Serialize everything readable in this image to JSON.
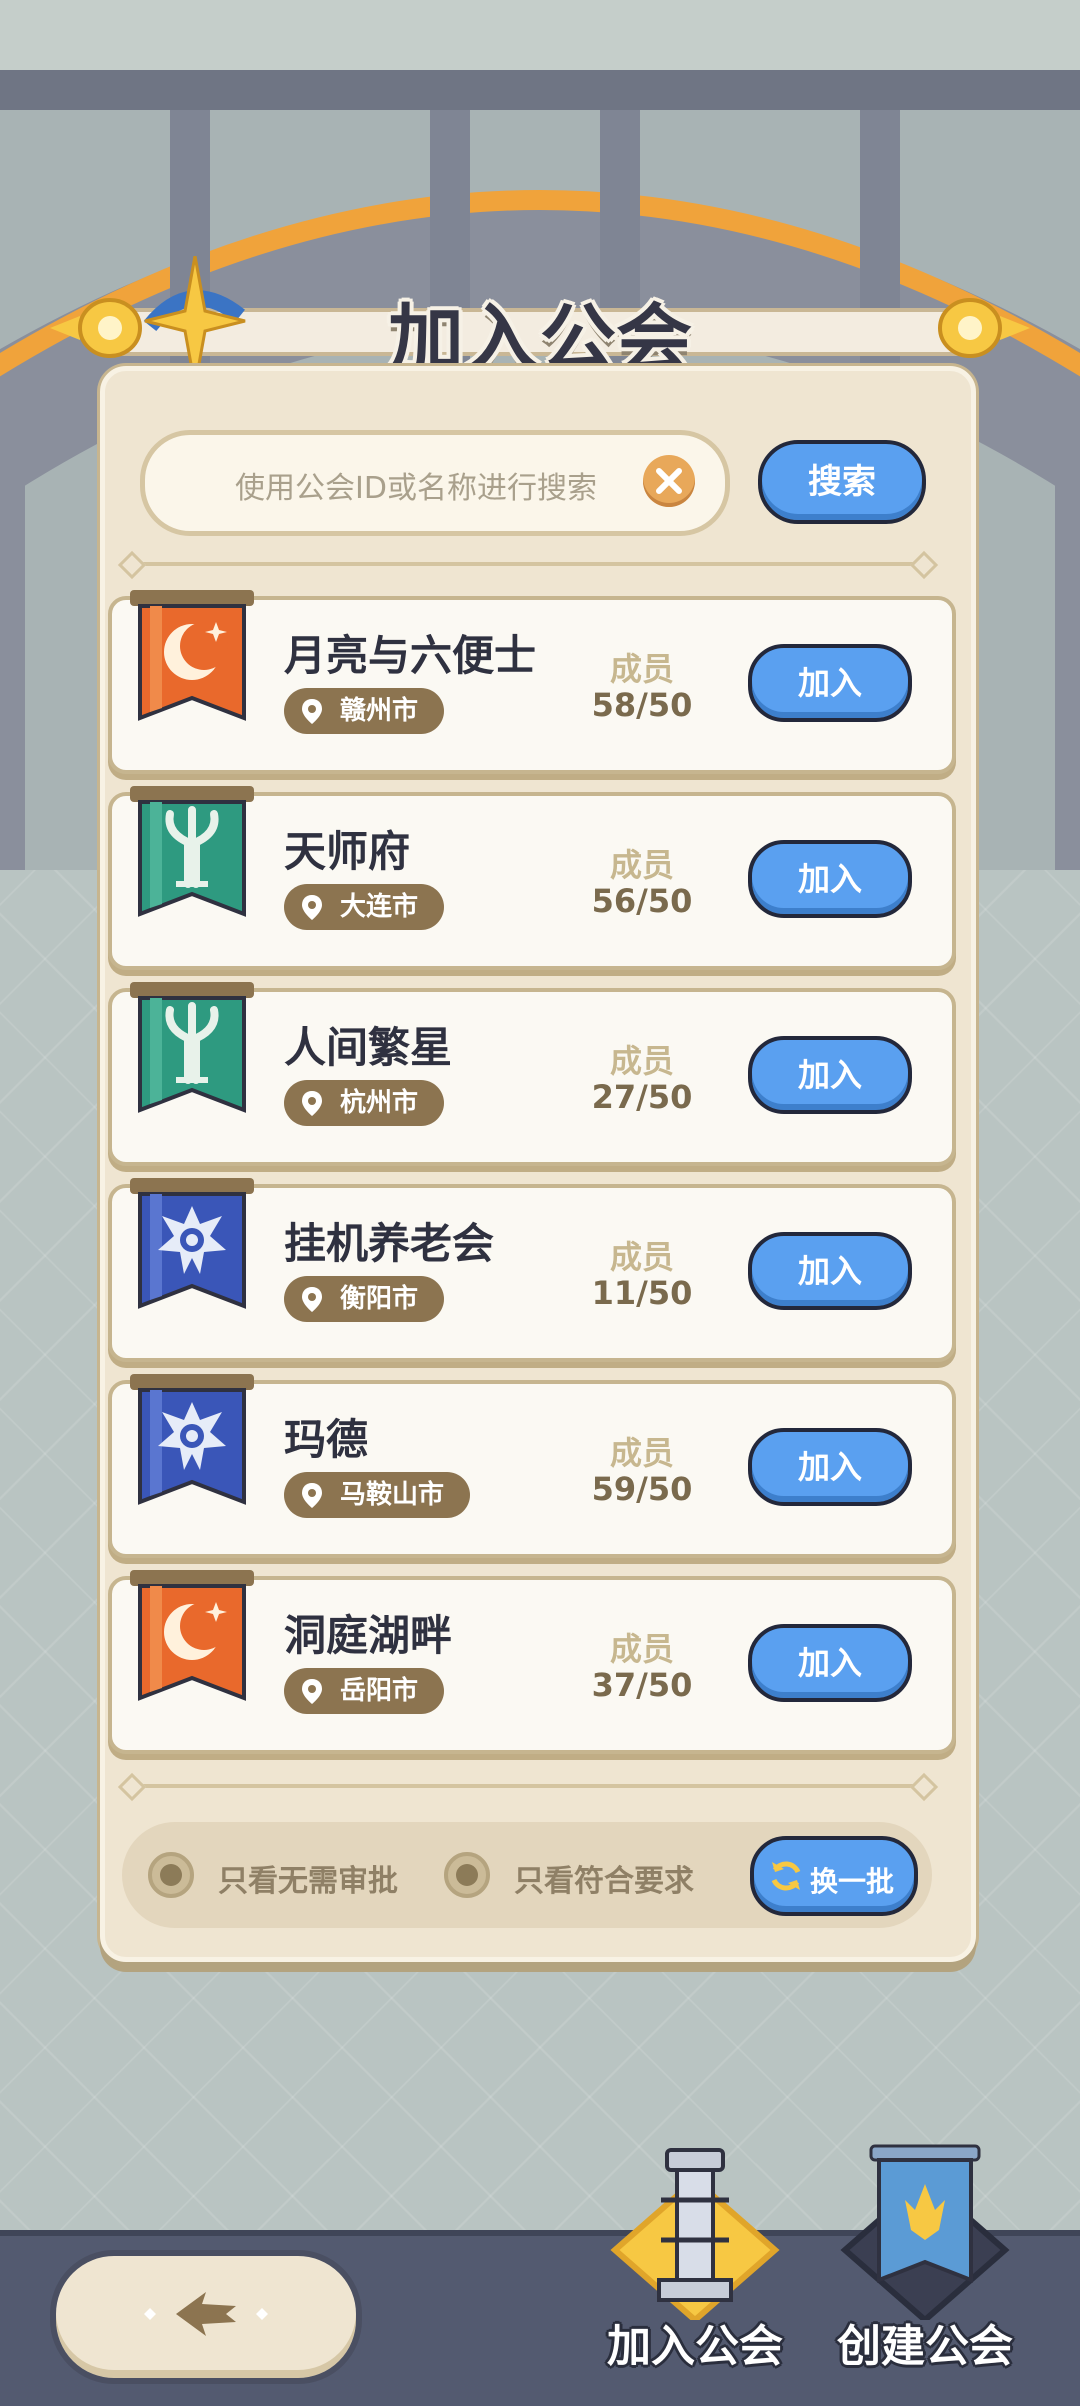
{
  "title": "加入公会",
  "search": {
    "placeholder": "使用公会ID或名称进行搜索",
    "button_label": "搜索"
  },
  "members_label": "成员",
  "join_label": "加入",
  "guilds": [
    {
      "name": "月亮与六便士",
      "location": "赣州市",
      "members": "58/50",
      "banner": "orange-moon-banner-icon"
    },
    {
      "name": "天师府",
      "location": "大连市",
      "members": "56/50",
      "banner": "green-tree-banner-icon"
    },
    {
      "name": "人间繁星",
      "location": "杭州市",
      "members": "27/50",
      "banner": "green-tree-banner-icon"
    },
    {
      "name": "挂机养老会",
      "location": "衡阳市",
      "members": "11/50",
      "banner": "blue-eye-banner-icon"
    },
    {
      "name": "玛德",
      "location": "马鞍山市",
      "members": "59/50",
      "banner": "blue-eye-banner-icon"
    },
    {
      "name": "洞庭湖畔",
      "location": "岳阳市",
      "members": "37/50",
      "banner": "orange-moon-banner-icon"
    }
  ],
  "filters": {
    "no_approval": "只看无需审批",
    "meets_requirements": "只看符合要求",
    "refresh_label": "换一批"
  },
  "tabs": [
    {
      "label": "加入公会",
      "icon": "tower-icon",
      "active": true
    },
    {
      "label": "创建公会",
      "icon": "banner-icon",
      "active": false
    }
  ],
  "colors": {
    "button_blue": "#5aa0f0",
    "panel": "#efe5d1",
    "orange_banner": "#e9692c",
    "green_banner": "#2e9a80",
    "blue_banner": "#3a56b8"
  }
}
